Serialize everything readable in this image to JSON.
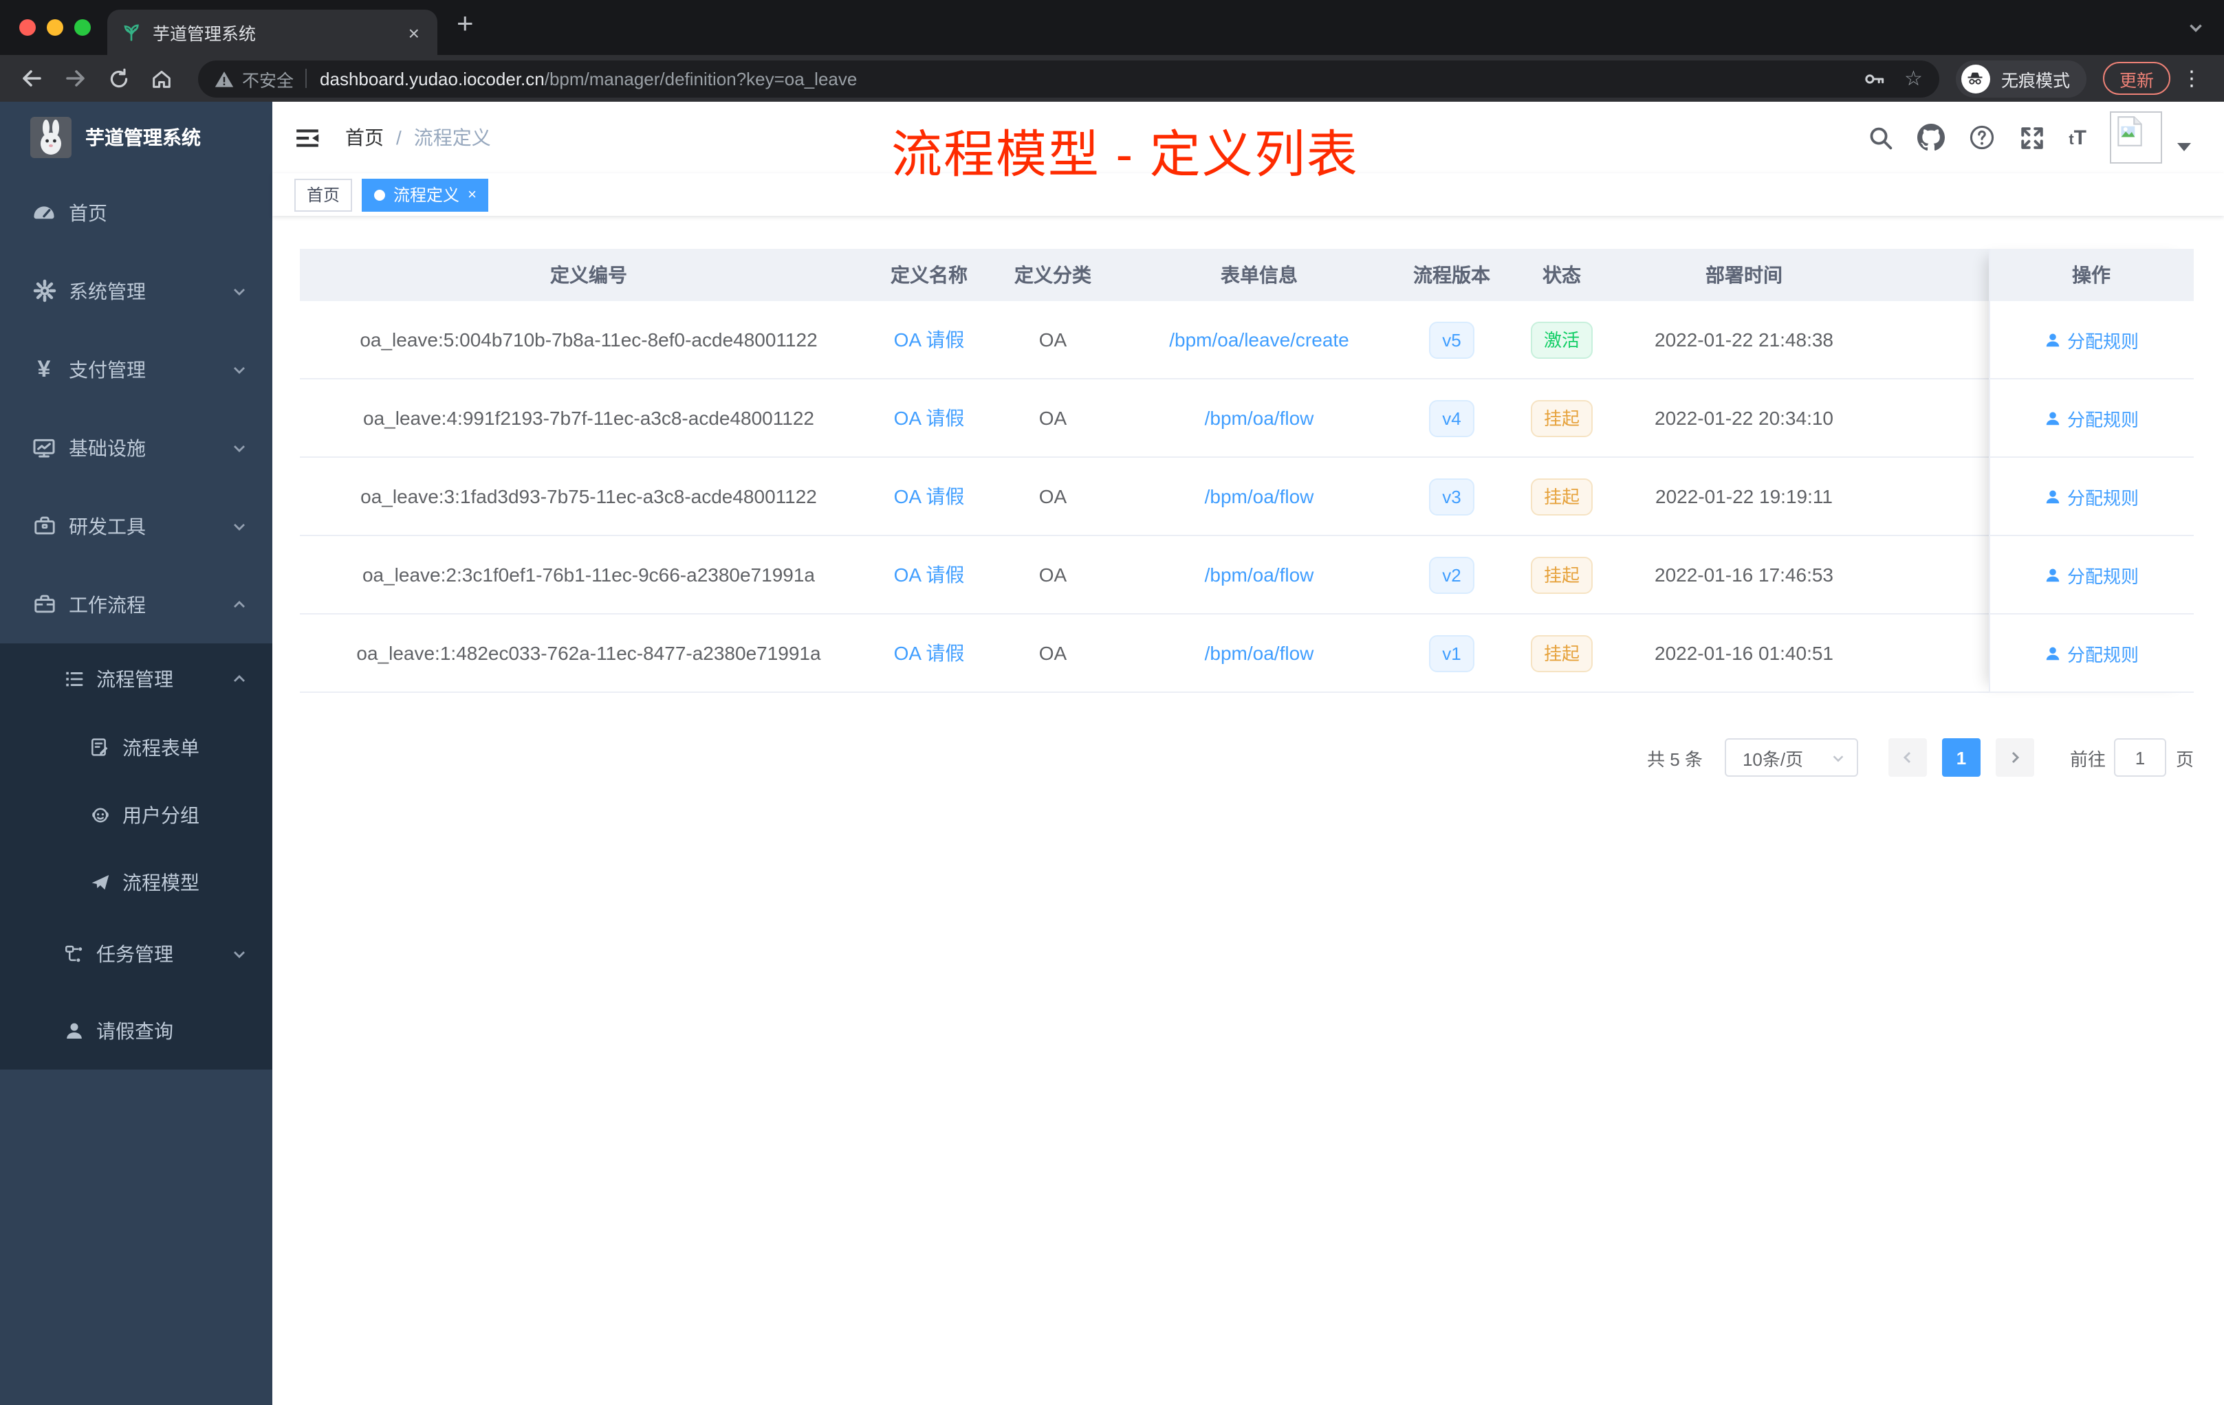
{
  "browser": {
    "tab_title": "芋道管理系统",
    "tab_close": "×",
    "new_tab": "+",
    "security_text": "不安全",
    "url_domain": "dashboard.yudao.iocoder.cn",
    "url_path": "/bpm/manager/definition?key=oa_leave",
    "incognito_label": "无痕模式",
    "update_label": "更新",
    "menu_dots": "⋮"
  },
  "sidebar": {
    "logo_title": "芋道管理系统",
    "items": [
      {
        "label": "首页",
        "icon": "dashboard-icon"
      },
      {
        "label": "系统管理",
        "icon": "gear-icon"
      },
      {
        "label": "支付管理",
        "icon": "yuan-icon",
        "glyph": "¥"
      },
      {
        "label": "基础设施",
        "icon": "monitor-icon"
      },
      {
        "label": "研发工具",
        "icon": "toolbox-icon"
      },
      {
        "label": "工作流程",
        "icon": "briefcase-icon"
      }
    ],
    "submenu": [
      {
        "label": "流程管理",
        "icon": "list-icon"
      },
      {
        "label": "流程表单",
        "icon": "form-icon"
      },
      {
        "label": "用户分组",
        "icon": "users-icon"
      },
      {
        "label": "流程模型",
        "icon": "send-icon"
      },
      {
        "label": "任务管理",
        "icon": "tree-icon"
      },
      {
        "label": "请假查询",
        "icon": "person-icon"
      }
    ]
  },
  "header": {
    "breadcrumb": [
      "首页",
      "流程定义"
    ],
    "breadcrumb_sep": "/"
  },
  "annotation": {
    "title": "流程模型 - 定义列表",
    "color": "#fe2b00"
  },
  "tags": [
    {
      "label": "首页",
      "active": false
    },
    {
      "label": "流程定义",
      "active": true,
      "close": "×"
    }
  ],
  "table": {
    "headers": [
      "定义编号",
      "定义名称",
      "定义分类",
      "表单信息",
      "流程版本",
      "状态",
      "部署时间",
      "操作"
    ],
    "action_label": "分配规则",
    "rows": [
      {
        "id": "oa_leave:5:004b710b-7b8a-11ec-8ef0-acde48001122",
        "name": "OA 请假",
        "category": "OA",
        "form": "/bpm/oa/leave/create",
        "version": "v5",
        "status": "激活",
        "status_type": "green",
        "time": "2022-01-22 21:48:38",
        "action": "分配规则"
      },
      {
        "id": "oa_leave:4:991f2193-7b7f-11ec-a3c8-acde48001122",
        "name": "OA 请假",
        "category": "OA",
        "form": "/bpm/oa/flow",
        "version": "v4",
        "status": "挂起",
        "status_type": "orange",
        "time": "2022-01-22 20:34:10",
        "action": "分配规则"
      },
      {
        "id": "oa_leave:3:1fad3d93-7b75-11ec-a3c8-acde48001122",
        "name": "OA 请假",
        "category": "OA",
        "form": "/bpm/oa/flow",
        "version": "v3",
        "status": "挂起",
        "status_type": "orange",
        "time": "2022-01-22 19:19:11",
        "action": "分配规则"
      },
      {
        "id": "oa_leave:2:3c1f0ef1-76b1-11ec-9c66-a2380e71991a",
        "name": "OA 请假",
        "category": "OA",
        "form": "/bpm/oa/flow",
        "version": "v2",
        "status": "挂起",
        "status_type": "orange",
        "time": "2022-01-16 17:46:53",
        "action": "分配规则"
      },
      {
        "id": "oa_leave:1:482ec033-762a-11ec-8477-a2380e71991a",
        "name": "OA 请假",
        "category": "OA",
        "form": "/bpm/oa/flow",
        "version": "v1",
        "status": "挂起",
        "status_type": "orange",
        "time": "2022-01-16 01:40:51",
        "action": "分配规则"
      }
    ]
  },
  "pagination": {
    "total_text": "共 5 条",
    "page_size": "10条/页",
    "current_page": "1",
    "goto_label": "前往",
    "goto_value": "1",
    "page_suffix": "页"
  },
  "colors": {
    "accent": "#409eff",
    "sidebar_bg": "#304156",
    "submenu_bg": "#1f2d3d",
    "success": "#13ce66",
    "warning": "#e6a23c",
    "annotation_red": "#fe2b00"
  }
}
